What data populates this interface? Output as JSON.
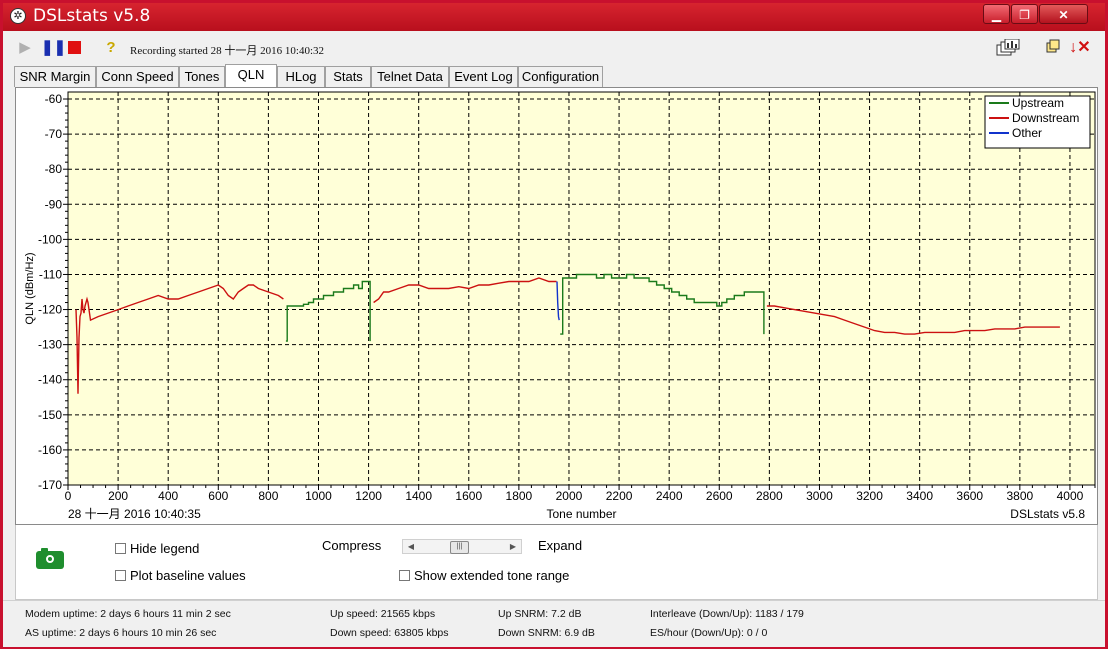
{
  "window": {
    "title": "DSLstats v5.8"
  },
  "toolbar": {
    "recording_text": "Recording started 28 十一月 2016 10:40:32"
  },
  "tabs": [
    "SNR Margin",
    "Conn Speed",
    "Tones",
    "QLN",
    "HLog",
    "Stats",
    "Telnet Data",
    "Event Log",
    "Configuration"
  ],
  "active_tab": "QLN",
  "chart_data": {
    "type": "line",
    "ylabel": "QLN (dBm/Hz)",
    "xlabel": "Tone number",
    "xlim": [
      0,
      4100
    ],
    "ylim": [
      -170,
      -58
    ],
    "x_ticks": [
      0,
      200,
      400,
      600,
      800,
      1000,
      1200,
      1400,
      1600,
      1800,
      2000,
      2200,
      2400,
      2600,
      2800,
      3000,
      3200,
      3400,
      3600,
      3800,
      4000
    ],
    "y_ticks": [
      -60,
      -70,
      -80,
      -90,
      -100,
      -110,
      -120,
      -130,
      -140,
      -150,
      -160,
      -170
    ],
    "grid": true,
    "background": "#ffffd8",
    "legend_position": "top-right",
    "timestamp": "28 十一月 2016 10:40:35",
    "version_label": "DSLstats v5.8",
    "series": [
      {
        "name": "Upstream",
        "color": "#1a7a1a",
        "step": true,
        "segments": [
          [
            [
              870,
              -129
            ],
            [
              875,
              -119
            ],
            [
              900,
              -119
            ],
            [
              940,
              -118.5
            ],
            [
              960,
              -118
            ],
            [
              980,
              -117
            ],
            [
              1000,
              -117
            ],
            [
              1020,
              -116
            ],
            [
              1040,
              -116
            ],
            [
              1060,
              -115
            ],
            [
              1080,
              -115
            ],
            [
              1100,
              -114
            ],
            [
              1120,
              -114
            ],
            [
              1140,
              -113
            ],
            [
              1160,
              -114
            ],
            [
              1175,
              -112
            ],
            [
              1190,
              -112
            ],
            [
              1205,
              -112
            ],
            [
              1206,
              -129
            ]
          ],
          [
            [
              1965,
              -127
            ],
            [
              1975,
              -111
            ],
            [
              2000,
              -111
            ],
            [
              2030,
              -110
            ],
            [
              2060,
              -110
            ],
            [
              2090,
              -110
            ],
            [
              2110,
              -111
            ],
            [
              2140,
              -110
            ],
            [
              2170,
              -111
            ],
            [
              2200,
              -111
            ],
            [
              2230,
              -110
            ],
            [
              2260,
              -111
            ],
            [
              2290,
              -111
            ],
            [
              2320,
              -112
            ],
            [
              2350,
              -113
            ],
            [
              2380,
              -114
            ],
            [
              2410,
              -115
            ],
            [
              2440,
              -116
            ],
            [
              2470,
              -117
            ],
            [
              2500,
              -118
            ],
            [
              2530,
              -118
            ],
            [
              2560,
              -118
            ],
            [
              2590,
              -119
            ],
            [
              2610,
              -118
            ],
            [
              2630,
              -117
            ],
            [
              2660,
              -116
            ],
            [
              2680,
              -116
            ],
            [
              2700,
              -115
            ],
            [
              2730,
              -115
            ],
            [
              2760,
              -115
            ],
            [
              2775,
              -115
            ],
            [
              2778,
              -127
            ]
          ]
        ]
      },
      {
        "name": "Downstream",
        "color": "#cc1111",
        "step": false,
        "segments": [
          [
            [
              32,
              -120
            ],
            [
              36,
              -128
            ],
            [
              40,
              -144
            ],
            [
              44,
              -128
            ],
            [
              48,
              -122
            ],
            [
              52,
              -121
            ],
            [
              56,
              -117
            ],
            [
              60,
              -120
            ],
            [
              64,
              -121
            ],
            [
              68,
              -119
            ],
            [
              72,
              -118
            ],
            [
              76,
              -117
            ],
            [
              80,
              -118
            ],
            [
              84,
              -120
            ],
            [
              90,
              -123
            ],
            [
              120,
              -122
            ],
            [
              160,
              -121
            ],
            [
              200,
              -120
            ],
            [
              240,
              -119
            ],
            [
              280,
              -118
            ],
            [
              320,
              -117
            ],
            [
              360,
              -116
            ],
            [
              400,
              -117
            ],
            [
              440,
              -117
            ],
            [
              480,
              -116
            ],
            [
              520,
              -115
            ],
            [
              560,
              -114
            ],
            [
              600,
              -113
            ],
            [
              620,
              -114
            ],
            [
              640,
              -116
            ],
            [
              660,
              -117
            ],
            [
              680,
              -115
            ],
            [
              700,
              -114
            ],
            [
              720,
              -113
            ],
            [
              740,
              -113
            ],
            [
              760,
              -114
            ],
            [
              800,
              -115
            ],
            [
              840,
              -116
            ],
            [
              860,
              -117
            ]
          ],
          [
            [
              1220,
              -118
            ],
            [
              1240,
              -117
            ],
            [
              1260,
              -115
            ],
            [
              1280,
              -115
            ],
            [
              1320,
              -114
            ],
            [
              1360,
              -113
            ],
            [
              1400,
              -113
            ],
            [
              1440,
              -114
            ],
            [
              1480,
              -114
            ],
            [
              1520,
              -114
            ],
            [
              1560,
              -113.5
            ],
            [
              1600,
              -114
            ],
            [
              1640,
              -113
            ],
            [
              1680,
              -113
            ],
            [
              1720,
              -112.5
            ],
            [
              1760,
              -112
            ],
            [
              1800,
              -112
            ],
            [
              1840,
              -112
            ],
            [
              1880,
              -111
            ],
            [
              1920,
              -112
            ],
            [
              1950,
              -112
            ]
          ],
          [
            [
              2790,
              -119
            ],
            [
              2820,
              -119
            ],
            [
              2860,
              -119.5
            ],
            [
              2900,
              -120
            ],
            [
              2940,
              -120.5
            ],
            [
              2980,
              -121
            ],
            [
              3020,
              -121.5
            ],
            [
              3060,
              -122
            ],
            [
              3100,
              -123
            ],
            [
              3140,
              -124
            ],
            [
              3180,
              -125
            ],
            [
              3220,
              -126
            ],
            [
              3260,
              -126.5
            ],
            [
              3300,
              -126.5
            ],
            [
              3340,
              -127
            ],
            [
              3380,
              -127
            ],
            [
              3420,
              -126.5
            ],
            [
              3460,
              -126.5
            ],
            [
              3500,
              -126.5
            ],
            [
              3540,
              -126.5
            ],
            [
              3580,
              -126
            ],
            [
              3620,
              -126
            ],
            [
              3660,
              -126
            ],
            [
              3700,
              -125.5
            ],
            [
              3740,
              -125.5
            ],
            [
              3780,
              -125.5
            ],
            [
              3820,
              -125
            ],
            [
              3860,
              -125
            ],
            [
              3900,
              -125
            ],
            [
              3940,
              -125
            ],
            [
              3960,
              -125
            ]
          ]
        ]
      },
      {
        "name": "Other",
        "color": "#1133cc",
        "step": false,
        "segments": [
          [
            [
              1952,
              -112
            ],
            [
              1955,
              -118
            ],
            [
              1958,
              -122
            ],
            [
              1961,
              -123
            ]
          ]
        ]
      }
    ]
  },
  "controls": {
    "hide_legend_label": "Hide legend",
    "plot_baseline_label": "Plot baseline values",
    "compress_label": "Compress",
    "expand_label": "Expand",
    "extended_tone_label": "Show extended tone range"
  },
  "status": {
    "modem_uptime": "Modem uptime: 2 days 6 hours 11 min 2 sec",
    "as_uptime": "AS uptime: 2 days 6 hours 10 min 26 sec",
    "up_speed": "Up speed: 21565 kbps",
    "down_speed": "Down speed: 63805 kbps",
    "up_snrm": "Up SNRM: 7.2 dB",
    "down_snrm": "Down SNRM: 6.9 dB",
    "interleave": "Interleave (Down/Up): 1183 / 179",
    "es_hour": "ES/hour (Down/Up): 0 / 0"
  }
}
